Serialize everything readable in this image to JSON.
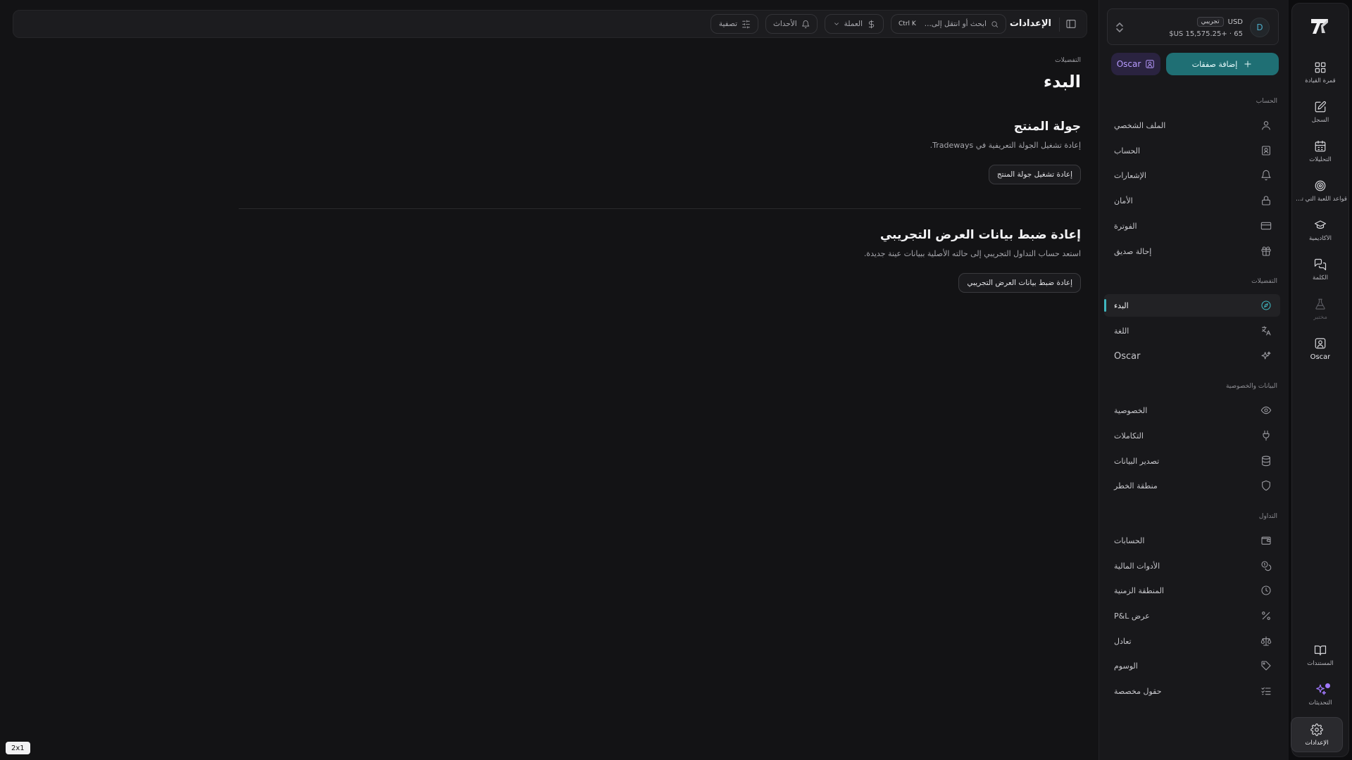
{
  "rail": {
    "items": [
      {
        "id": "dashboard",
        "label": "قمرة القيادة",
        "icon": "dashboard-icon"
      },
      {
        "id": "journal",
        "label": "السجل",
        "icon": "journal-icon"
      },
      {
        "id": "analytics",
        "label": "التحليلات",
        "icon": "calendar-icon"
      },
      {
        "id": "playbook",
        "label": "قواعد اللعبة التي تما...",
        "icon": "target-icon"
      },
      {
        "id": "academy",
        "label": "الأكاديمية",
        "icon": "graduation-cap-icon"
      },
      {
        "id": "chat",
        "label": "الكلمة",
        "icon": "chat-icon"
      },
      {
        "id": "lab",
        "label": "مختبر",
        "icon": "flask-icon"
      },
      {
        "id": "oscar",
        "label": "Oscar",
        "icon": "oscar-icon"
      }
    ],
    "bottom": [
      {
        "id": "docs",
        "label": "المستندات",
        "icon": "book-icon"
      },
      {
        "id": "updates",
        "label": "التحديثات",
        "icon": "sparkles-icon"
      },
      {
        "id": "settings",
        "label": "الإعدادات",
        "icon": "gear-icon"
      }
    ]
  },
  "account": {
    "avatar": "D",
    "badge": "تجريبي",
    "currency": "USD",
    "balance": "$US 15,575.25+ · 65"
  },
  "buttons": {
    "add_trades": "إضافة صفقات",
    "oscar": "Oscar"
  },
  "sections": {
    "account": "الحساب",
    "preferences": "التفضيلات",
    "data_privacy": "البيانات والخصوصية",
    "trading": "التداول"
  },
  "nav": {
    "account": [
      {
        "label": "الملف الشخصي",
        "icon": "user-icon"
      },
      {
        "label": "الحساب",
        "icon": "id-card-icon"
      },
      {
        "label": "الإشعارات",
        "icon": "bell-icon"
      },
      {
        "label": "الأمان",
        "icon": "lock-icon"
      },
      {
        "label": "الفوترة",
        "icon": "credit-card-icon"
      },
      {
        "label": "إحالة صديق",
        "icon": "gift-icon"
      }
    ],
    "preferences": [
      {
        "label": "البدء",
        "icon": "compass-icon",
        "active": true
      },
      {
        "label": "اللغة",
        "icon": "translate-icon"
      },
      {
        "label": "Oscar",
        "icon": "sparkles-icon"
      }
    ],
    "data_privacy": [
      {
        "label": "الخصوصية",
        "icon": "eye-icon"
      },
      {
        "label": "التكاملات",
        "icon": "plug-icon"
      },
      {
        "label": "تصدير البيانات",
        "icon": "database-icon"
      },
      {
        "label": "منطقة الخطر",
        "icon": "shield-icon"
      }
    ],
    "trading": [
      {
        "label": "الحسابات",
        "icon": "wallet-icon"
      },
      {
        "label": "الأدوات المالية",
        "icon": "coins-icon"
      },
      {
        "label": "المنطقة الزمنية",
        "icon": "clock-icon"
      },
      {
        "label": "عرض P&L",
        "icon": "percent-icon"
      },
      {
        "label": "تعادل",
        "icon": "scale-icon"
      },
      {
        "label": "الوسوم",
        "icon": "tag-icon"
      },
      {
        "label": "حقول مخصصة",
        "icon": "list-checks-icon"
      }
    ]
  },
  "topbar": {
    "title": "الإعدادات",
    "search_placeholder": "ابحث أو انتقل إلى...",
    "search_shortcut": "Ctrl K",
    "currency": "العملة",
    "events": "الأحداث",
    "filter": "تصفية"
  },
  "main": {
    "breadcrumb": "التفضيلات",
    "title": "البدء",
    "tour": {
      "title": "جولة المنتج",
      "desc": "إعادة تشغيل الجولة التعريفية في Tradeways.",
      "button": "إعادة تشغيل جولة المنتج"
    },
    "reset": {
      "title": "إعادة ضبط بيانات العرض التجريبي",
      "desc": "استعد حساب التداول التجريبي إلى حالته الأصلية ببيانات عينة جديدة.",
      "button": "إعادة ضبط بيانات العرض التجريبي"
    }
  },
  "zoom_tag": "2x1"
}
